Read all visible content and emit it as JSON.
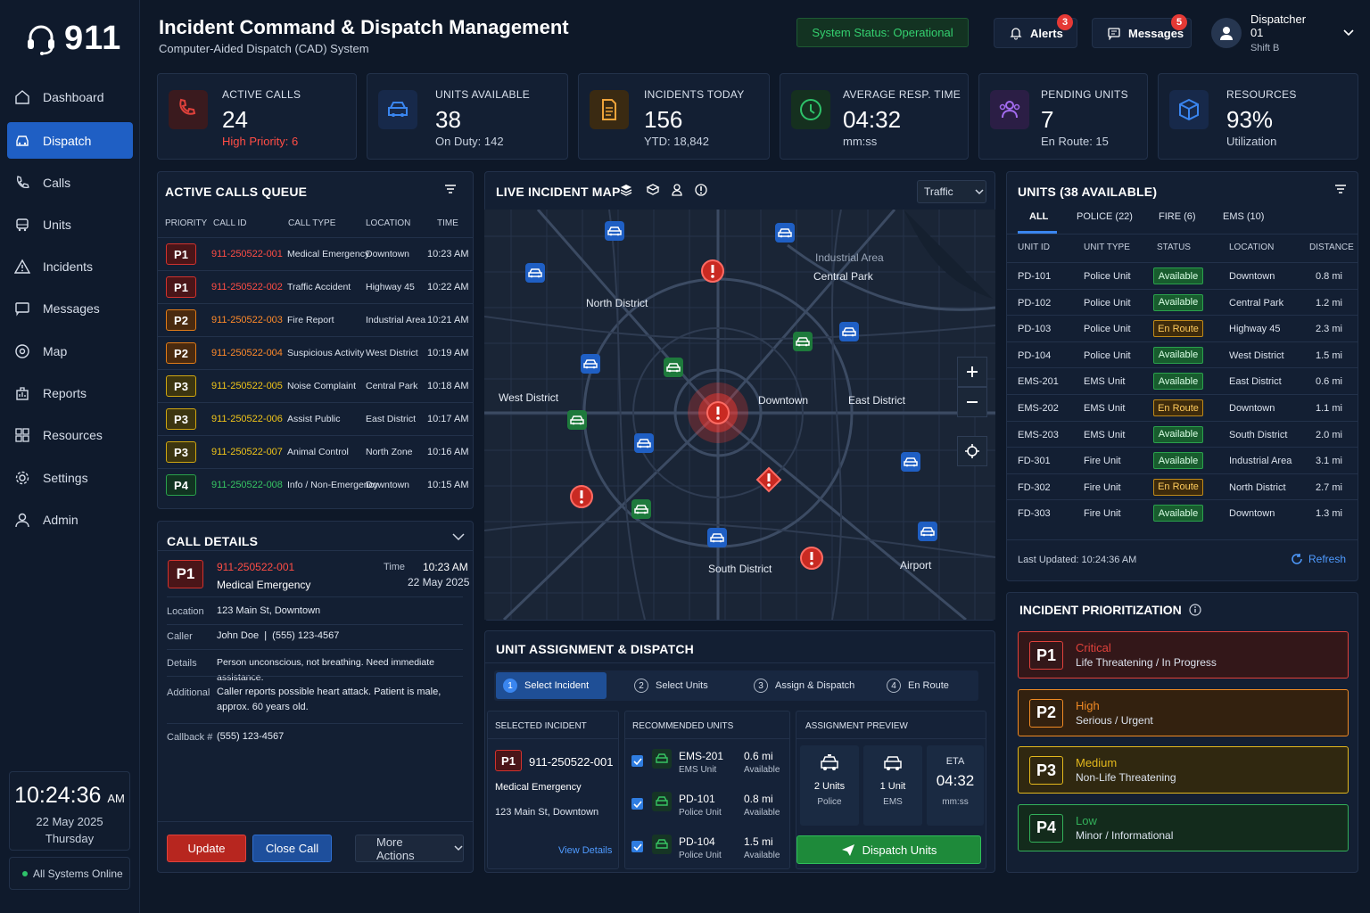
{
  "app": {
    "logo": "911"
  },
  "nav": [
    {
      "label": "Dashboard",
      "icon": "home-icon"
    },
    {
      "label": "Dispatch",
      "icon": "car-icon",
      "active": true
    },
    {
      "label": "Calls",
      "icon": "phone-icon"
    },
    {
      "label": "Units",
      "icon": "bus-icon"
    },
    {
      "label": "Incidents",
      "icon": "warning-icon"
    },
    {
      "label": "Messages",
      "icon": "message-icon"
    },
    {
      "label": "Map",
      "icon": "map-pin-icon"
    },
    {
      "label": "Reports",
      "icon": "report-icon"
    },
    {
      "label": "Resources",
      "icon": "grid-icon"
    },
    {
      "label": "Settings",
      "icon": "gear-icon"
    },
    {
      "label": "Admin",
      "icon": "user-icon"
    }
  ],
  "clock": {
    "time": "10:24:36",
    "ampm": "AM",
    "date": "22 May 2025",
    "day": "Thursday"
  },
  "systems": "All Systems Online",
  "header": {
    "title": "Incident Command & Dispatch Management",
    "subtitle": "Computer-Aided Dispatch (CAD) System",
    "status": "System Status: Operational",
    "alerts_label": "Alerts",
    "alerts_count": "3",
    "messages_label": "Messages",
    "messages_count": "5",
    "user_name": "Dispatcher 01",
    "user_shift": "Shift B"
  },
  "stats": [
    {
      "label": "ACTIVE CALLS",
      "value": "24",
      "sub": "High Priority: 6",
      "color": "#e0413b"
    },
    {
      "label": "UNITS AVAILABLE",
      "value": "38",
      "sub": "On Duty: 142",
      "color": "#3a86f0"
    },
    {
      "label": "INCIDENTS TODAY",
      "value": "156",
      "sub": "YTD: 18,842",
      "color": "#f0a43a"
    },
    {
      "label": "AVERAGE RESP. TIME",
      "value": "04:32",
      "sub": "mm:ss",
      "color": "#2ec26a"
    },
    {
      "label": "PENDING UNITS",
      "value": "7",
      "sub": "En Route: 15",
      "color": "#a46cf0"
    },
    {
      "label": "RESOURCES",
      "value": "93%",
      "sub": "Utilization",
      "color": "#3a86f0"
    }
  ],
  "queue": {
    "title": "ACTIVE CALLS QUEUE",
    "headers": [
      "PRIORITY",
      "CALL ID",
      "CALL TYPE",
      "LOCATION",
      "TIME"
    ],
    "rows": [
      {
        "p": "P1",
        "id": "911-250522-001",
        "type": "Medical Emergency",
        "loc": "Downtown",
        "time": "10:23 AM"
      },
      {
        "p": "P1",
        "id": "911-250522-002",
        "type": "Traffic Accident",
        "loc": "Highway 45",
        "time": "10:22 AM"
      },
      {
        "p": "P2",
        "id": "911-250522-003",
        "type": "Fire Report",
        "loc": "Industrial Area",
        "time": "10:21 AM"
      },
      {
        "p": "P2",
        "id": "911-250522-004",
        "type": "Suspicious Activity",
        "loc": "West District",
        "time": "10:19 AM"
      },
      {
        "p": "P3",
        "id": "911-250522-005",
        "type": "Noise Complaint",
        "loc": "Central Park",
        "time": "10:18 AM"
      },
      {
        "p": "P3",
        "id": "911-250522-006",
        "type": "Assist Public",
        "loc": "East District",
        "time": "10:17 AM"
      },
      {
        "p": "P3",
        "id": "911-250522-007",
        "type": "Animal Control",
        "loc": "North Zone",
        "time": "10:16 AM"
      },
      {
        "p": "P4",
        "id": "911-250522-008",
        "type": "Info / Non-Emergency",
        "loc": "Downtown",
        "time": "10:15 AM"
      }
    ]
  },
  "details": {
    "title": "CALL DETAILS",
    "prio": "P1",
    "id": "911-250522-001",
    "type": "Medical Emergency",
    "time_label": "Time",
    "time": "10:23 AM",
    "date": "22 May 2025",
    "location_label": "Location",
    "location": "123 Main St, Downtown",
    "caller_label": "Caller",
    "caller": "John Doe  |  (555) 123-4567",
    "details_label": "Details",
    "details": "Person unconscious, not breathing. Need immediate assistance.",
    "additional_label": "Additional",
    "additional": "Caller reports possible heart attack. Patient is male, approx. 60 years old.",
    "callback_label": "Callback #",
    "callback": "(555) 123-4567",
    "update": "Update",
    "close": "Close Call",
    "more": "More Actions"
  },
  "map": {
    "title": "LIVE INCIDENT MAP",
    "layer": "Traffic",
    "labels": [
      "Industrial Area",
      "Central Park",
      "North District",
      "West District",
      "Downtown",
      "East District",
      "South District",
      "Airport"
    ]
  },
  "units": {
    "title": "UNITS (38 AVAILABLE)",
    "tabs": [
      "ALL",
      "POLICE (22)",
      "FIRE (6)",
      "EMS (10)"
    ],
    "headers": [
      "UNIT ID",
      "UNIT TYPE",
      "STATUS",
      "LOCATION",
      "DISTANCE"
    ],
    "rows": [
      {
        "id": "PD-101",
        "type": "Police Unit",
        "status": "Available",
        "loc": "Downtown",
        "dist": "0.8 mi"
      },
      {
        "id": "PD-102",
        "type": "Police Unit",
        "status": "Available",
        "loc": "Central Park",
        "dist": "1.2 mi"
      },
      {
        "id": "PD-103",
        "type": "Police Unit",
        "status": "En Route",
        "loc": "Highway 45",
        "dist": "2.3 mi"
      },
      {
        "id": "PD-104",
        "type": "Police Unit",
        "status": "Available",
        "loc": "West District",
        "dist": "1.5 mi"
      },
      {
        "id": "EMS-201",
        "type": "EMS Unit",
        "status": "Available",
        "loc": "East District",
        "dist": "0.6 mi"
      },
      {
        "id": "EMS-202",
        "type": "EMS Unit",
        "status": "En Route",
        "loc": "Downtown",
        "dist": "1.1 mi"
      },
      {
        "id": "EMS-203",
        "type": "EMS Unit",
        "status": "Available",
        "loc": "South District",
        "dist": "2.0 mi"
      },
      {
        "id": "FD-301",
        "type": "Fire Unit",
        "status": "Available",
        "loc": "Industrial Area",
        "dist": "3.1 mi"
      },
      {
        "id": "FD-302",
        "type": "Fire Unit",
        "status": "En Route",
        "loc": "North District",
        "dist": "2.7 mi"
      },
      {
        "id": "FD-303",
        "type": "Fire Unit",
        "status": "Available",
        "loc": "Downtown",
        "dist": "1.3 mi"
      }
    ],
    "updated": "Last Updated: 10:24:36 AM",
    "refresh": "Refresh"
  },
  "prioritization": {
    "title": "INCIDENT PRIORITIZATION",
    "items": [
      {
        "p": "P1",
        "title": "Critical",
        "desc": "Life Threatening / In Progress",
        "color": "#e0413b"
      },
      {
        "p": "P2",
        "title": "High",
        "desc": "Serious / Urgent",
        "color": "#f08a24"
      },
      {
        "p": "P3",
        "title": "Medium",
        "desc": "Non-Life Threatening",
        "color": "#e3b81c"
      },
      {
        "p": "P4",
        "title": "Low",
        "desc": "Minor / Informational",
        "color": "#33b05a"
      }
    ]
  },
  "dispatch": {
    "title": "UNIT ASSIGNMENT & DISPATCH",
    "steps": [
      "Select Incident",
      "Select Units",
      "Assign & Dispatch",
      "En Route"
    ],
    "sel_title": "SELECTED INCIDENT",
    "sel_prio": "P1",
    "sel_id": "911-250522-001",
    "sel_type": "Medical Emergency",
    "sel_loc": "123 Main St, Downtown",
    "view": "View Details",
    "rec_title": "RECOMMENDED UNITS",
    "rec": [
      {
        "id": "EMS-201",
        "type": "EMS Unit",
        "dist": "0.6 mi",
        "status": "Available"
      },
      {
        "id": "PD-101",
        "type": "Police Unit",
        "dist": "0.8 mi",
        "status": "Available"
      },
      {
        "id": "PD-104",
        "type": "Police Unit",
        "dist": "1.5 mi",
        "status": "Available"
      }
    ],
    "prev_title": "ASSIGNMENT PREVIEW",
    "prev_police_count": "2 Units",
    "prev_police": "Police",
    "prev_ems_count": "1 Unit",
    "prev_ems": "EMS",
    "eta_label": "ETA",
    "eta": "04:32",
    "eta_unit": "mm:ss",
    "dispatch_btn": "Dispatch Units"
  }
}
